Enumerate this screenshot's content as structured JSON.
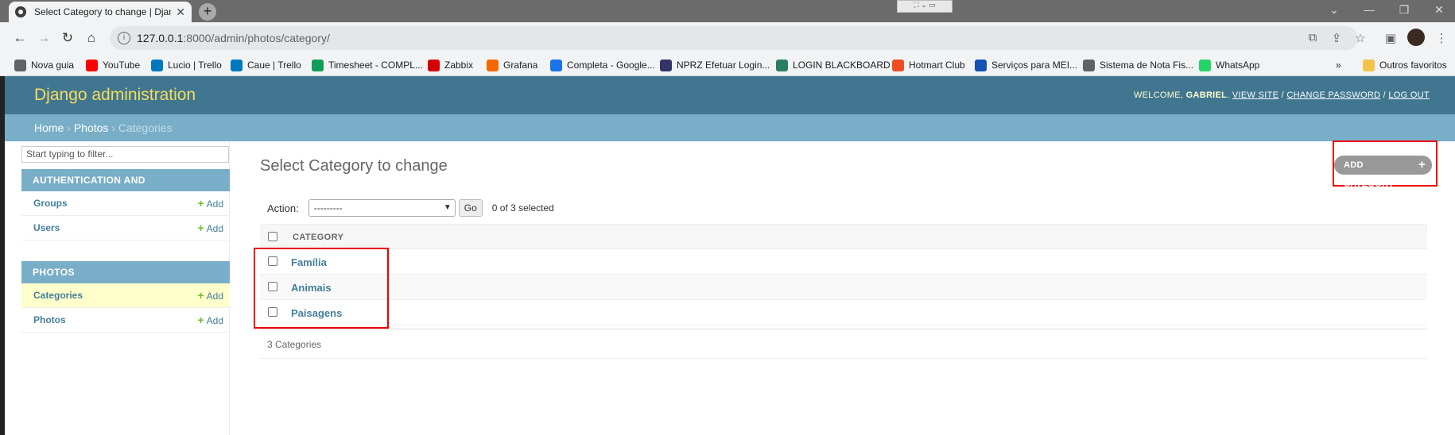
{
  "browser": {
    "tab_title": "Select Category to change | Djan",
    "tab_close": "✕",
    "new_tab": "+",
    "url_host": "127.0.0.1",
    "url_path": ":8000/admin/photos/category/",
    "bookmarks": [
      {
        "label": "Nova guia",
        "color": "#5f6368"
      },
      {
        "label": "YouTube",
        "color": "#ff0000"
      },
      {
        "label": "Lucio | Trello",
        "color": "#0079bf"
      },
      {
        "label": "Caue | Trello",
        "color": "#0079bf"
      },
      {
        "label": "Timesheet - COMPL...",
        "color": "#0f9d58"
      },
      {
        "label": "Zabbix",
        "color": "#d40000"
      },
      {
        "label": "Grafana",
        "color": "#f46800"
      },
      {
        "label": "Completa - Google...",
        "color": "#1a73e8"
      },
      {
        "label": "NPRZ Efetuar Login...",
        "color": "#333366"
      },
      {
        "label": "LOGIN BLACKBOARD",
        "color": "#2a7f62"
      },
      {
        "label": "Hotmart Club",
        "color": "#ef4e23"
      },
      {
        "label": "Serviços para MEI...",
        "color": "#1351b4"
      },
      {
        "label": "Sistema de Nota Fis...",
        "color": "#5f6368"
      },
      {
        "label": "WhatsApp",
        "color": "#25d366"
      }
    ],
    "bookmarks_more": "»",
    "other_bookmarks": "Outros favoritos"
  },
  "header": {
    "brand": "Django administration",
    "welcome": "Welcome,",
    "user": "gabriel",
    "view_site": "View site",
    "change_password": "Change password",
    "log_out": "Log out",
    "sep": " / "
  },
  "breadcrumbs": {
    "home": "Home",
    "app": "Photos",
    "current": "Categories",
    "sep": " › "
  },
  "sidebar": {
    "filter_placeholder": "Start typing to filter...",
    "modules": [
      {
        "caption": "Authentication and Authorization",
        "models": [
          {
            "name": "Groups",
            "add": "Add"
          },
          {
            "name": "Users",
            "add": "Add"
          }
        ]
      },
      {
        "caption": "Photos",
        "models": [
          {
            "name": "Categories",
            "add": "Add"
          },
          {
            "name": "Photos",
            "add": "Add"
          }
        ]
      }
    ]
  },
  "content": {
    "title": "Select Category to change",
    "add_button": "Add category",
    "action_label": "Action:",
    "action_selected": "---------",
    "go_label": "Go",
    "selected_count": "0 of 3 selected",
    "column_header": "CATEGORY",
    "rows": [
      "Família",
      "Animais",
      "Paisagens"
    ],
    "paginator": "3 Categories"
  },
  "colors": {
    "header_bg": "#417690",
    "breadcrumbs_bg": "#79aec8",
    "brand": "#f5dd5d",
    "link": "#447e9b",
    "highlight_box": "#e00000"
  }
}
